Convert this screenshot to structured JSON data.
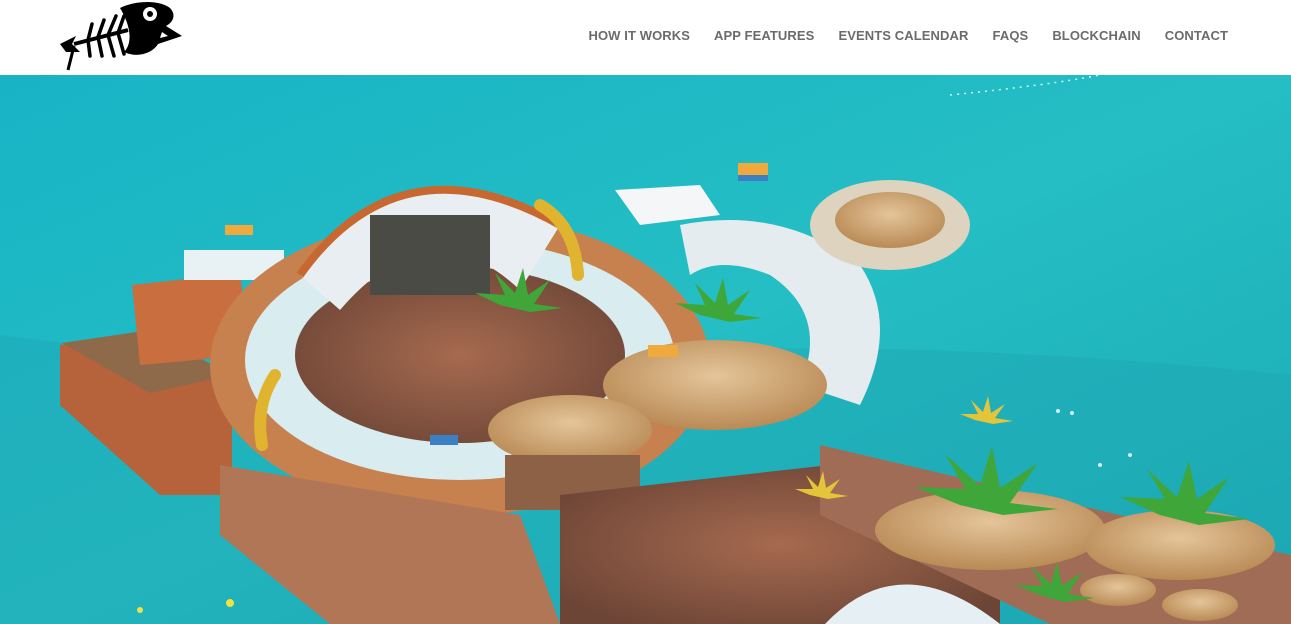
{
  "header": {
    "logo_icon": "fish-skeleton-logo-icon",
    "nav": [
      {
        "label": "HOW IT WORKS"
      },
      {
        "label": "APP FEATURES"
      },
      {
        "label": "EVENTS CALENDAR"
      },
      {
        "label": "FAQS"
      },
      {
        "label": "BLOCKCHAIN"
      },
      {
        "label": "CONTACT"
      }
    ]
  },
  "colors": {
    "nav_text": "#6b6b6b",
    "sea": "#21b9c3",
    "header_bg": "#ffffff"
  },
  "hero": {
    "image_subject": "aerial-photo-floating-beach-club-party"
  }
}
